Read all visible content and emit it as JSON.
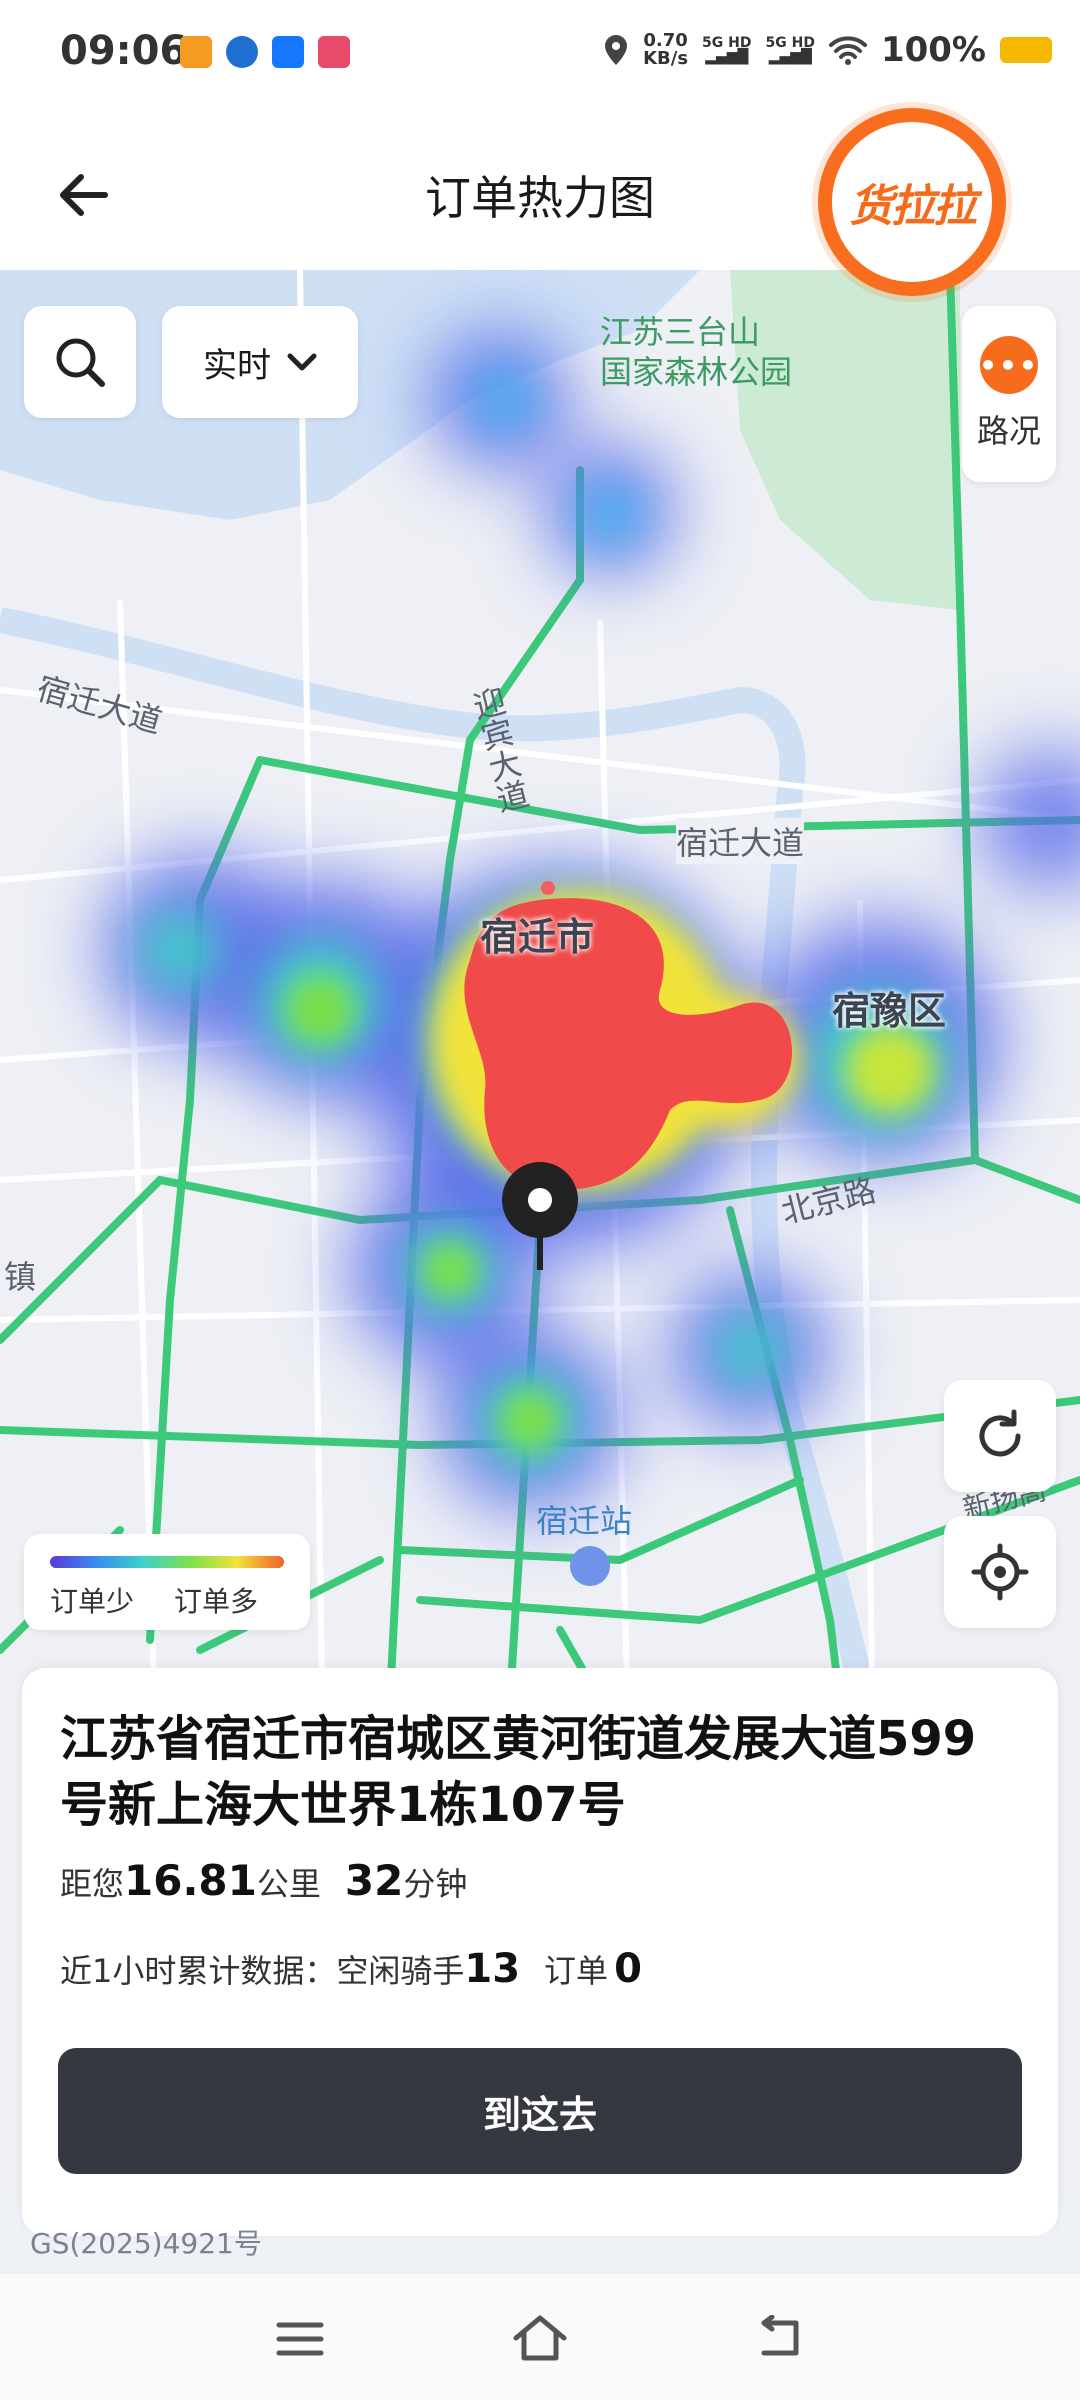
{
  "status_bar": {
    "time": "09:06",
    "net_speed_value": "0.70",
    "net_speed_unit": "KB/s",
    "signal1": "5G HD",
    "signal2": "5G HD",
    "battery": "100%"
  },
  "header": {
    "title": "订单热力图",
    "logo_text": "货拉拉"
  },
  "map_controls": {
    "mode": "实时",
    "traffic_label": "路况",
    "traffic_icon": "more-dots-icon"
  },
  "map_labels": {
    "park": "江苏三台山\n国家森林公园",
    "road_suqian_west": "宿迁大道",
    "road_suqian_east": "宿迁大道",
    "road_yingbin": "迎宾大道",
    "city": "宿迁市",
    "district": "宿豫区",
    "road_beijing": "北京路",
    "station": "宿迁站",
    "town": "镇",
    "road_xinyang": "新扬高"
  },
  "legend": {
    "low": "订单少",
    "high": "订单多"
  },
  "info_card": {
    "address": "江苏省宿迁市宿城区黄河街道发展大道599号新上海大世界1栋107号",
    "distance_prefix": "距您",
    "distance_value": "16.81",
    "distance_unit": "公里",
    "time_value": "32",
    "time_unit": "分钟",
    "stats_prefix": "近1小时累计数据：空闲骑手",
    "idle_riders": "13",
    "orders_label": "订单",
    "orders": "0",
    "button_label": "到这去"
  },
  "map_copyright": "GS(2025)4921号",
  "colors": {
    "brand_orange": "#f96d1f",
    "road_green": "#3cc97a",
    "button_dark": "#353841",
    "water": "#cfe0f5"
  }
}
